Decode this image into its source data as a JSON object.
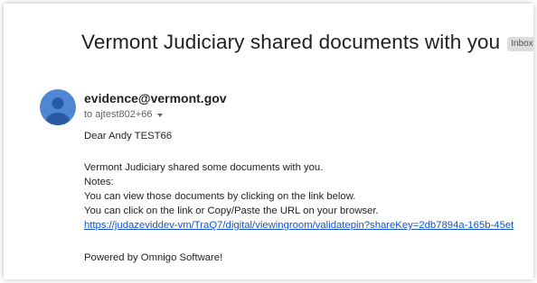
{
  "email": {
    "subject": "Vermont Judiciary shared documents with you",
    "label": "Inbox",
    "label_close": "×",
    "sender": "evidence@vermont.gov",
    "recipient": "to ajtest802+66",
    "body": {
      "greeting": "Dear Andy TEST66",
      "line1": "Vermont Judiciary shared some documents with you.",
      "line2": "Notes:",
      "line3": "You can view those documents by clicking on the link below.",
      "line4": "You can click on the link or Copy/Paste the URL on your browser.",
      "link": "https://judazeviddev-vm/TraQ7/digital/viewingroom/validatepin?shareKey=2db7894a-165b-45et",
      "footer": "Powered by Omnigo Software!"
    }
  },
  "icons": {
    "avatar": "person-icon",
    "caret": "caret-down-icon"
  },
  "colors": {
    "avatar_bg": "#4f87d2",
    "link": "#1155cc",
    "chip_bg": "#dddddd"
  }
}
